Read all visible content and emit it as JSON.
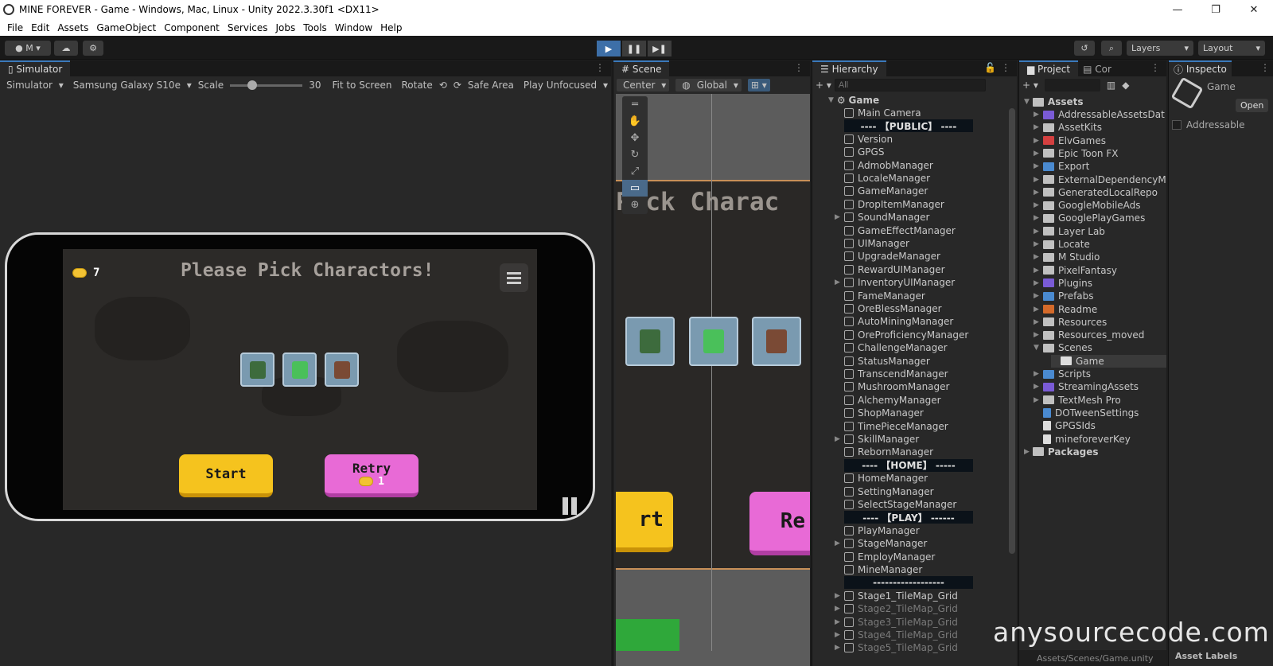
{
  "window": {
    "title": "MINE  FOREVER - Game - Windows, Mac, Linux - Unity 2022.3.30f1 <DX11>"
  },
  "menu": [
    "File",
    "Edit",
    "Assets",
    "GameObject",
    "Component",
    "Services",
    "Jobs",
    "Tools",
    "Window",
    "Help"
  ],
  "toolbar": {
    "account": "M",
    "layers": "Layers",
    "layout": "Layout"
  },
  "simulator": {
    "tab": "Simulator",
    "mode": "Simulator",
    "device": "Samsung Galaxy S10e",
    "scale_label": "Scale",
    "scale_value": "30",
    "fit": "Fit to Screen",
    "rotate": "Rotate",
    "safe_area": "Safe Area",
    "play_mode": "Play Unfocused"
  },
  "game": {
    "coins": "7",
    "title": "Please Pick Charactors!",
    "start": "Start",
    "retry": "Retry",
    "retry_cost": "1"
  },
  "scene": {
    "tab": "Scene",
    "pivot": "Center",
    "space": "Global",
    "banner": "Pick Charac",
    "btn_left": "rt",
    "btn_right": "Re"
  },
  "hierarchy": {
    "tab": "Hierarchy",
    "search_placeholder": "All",
    "root": "Game",
    "items": [
      {
        "label": "Main Camera",
        "type": "obj"
      },
      {
        "label": "---- 【PUBLIC】 ----",
        "type": "sep"
      },
      {
        "label": "Version",
        "type": "obj"
      },
      {
        "label": "GPGS",
        "type": "obj"
      },
      {
        "label": "AdmobManager",
        "type": "obj"
      },
      {
        "label": "LocaleManager",
        "type": "obj"
      },
      {
        "label": "GameManager",
        "type": "obj"
      },
      {
        "label": "DropItemManager",
        "type": "obj"
      },
      {
        "label": "SoundManager",
        "type": "obj",
        "arrow": true
      },
      {
        "label": "GameEffectManager",
        "type": "obj"
      },
      {
        "label": "UIManager",
        "type": "obj"
      },
      {
        "label": "UpgradeManager",
        "type": "obj"
      },
      {
        "label": "RewardUIManager",
        "type": "obj"
      },
      {
        "label": "InventoryUIManager",
        "type": "obj",
        "arrow": true
      },
      {
        "label": "FameManager",
        "type": "obj"
      },
      {
        "label": "OreBlessManager",
        "type": "obj"
      },
      {
        "label": "AutoMiningManager",
        "type": "obj"
      },
      {
        "label": "OreProficiencyManager",
        "type": "obj"
      },
      {
        "label": "ChallengeManager",
        "type": "obj"
      },
      {
        "label": "StatusManager",
        "type": "obj"
      },
      {
        "label": "TranscendManager",
        "type": "obj"
      },
      {
        "label": "MushroomManager",
        "type": "obj"
      },
      {
        "label": "AlchemyManager",
        "type": "obj"
      },
      {
        "label": "ShopManager",
        "type": "obj"
      },
      {
        "label": "TimePieceManager",
        "type": "obj"
      },
      {
        "label": "SkillManager",
        "type": "obj",
        "arrow": true
      },
      {
        "label": "RebornManager",
        "type": "obj"
      },
      {
        "label": "---- 【HOME】 -----",
        "type": "sep"
      },
      {
        "label": "HomeManager",
        "type": "obj"
      },
      {
        "label": "SettingManager",
        "type": "obj"
      },
      {
        "label": "SelectStageManager",
        "type": "obj"
      },
      {
        "label": "---- 【PLAY】 ------",
        "type": "sep"
      },
      {
        "label": "PlayManager",
        "type": "obj"
      },
      {
        "label": "StageManager",
        "type": "obj",
        "arrow": true
      },
      {
        "label": "EmployManager",
        "type": "obj"
      },
      {
        "label": "MineManager",
        "type": "obj"
      },
      {
        "label": "------------------",
        "type": "sep"
      },
      {
        "label": "Stage1_TileMap_Grid",
        "type": "obj",
        "arrow": true
      },
      {
        "label": "Stage2_TileMap_Grid",
        "type": "dim",
        "arrow": true
      },
      {
        "label": "Stage3_TileMap_Grid",
        "type": "dim",
        "arrow": true
      },
      {
        "label": "Stage4_TileMap_Grid",
        "type": "dim",
        "arrow": true
      },
      {
        "label": "Stage5_TileMap_Grid",
        "type": "dim",
        "arrow": true
      }
    ]
  },
  "project": {
    "tab": "Project",
    "tab2": "Cor",
    "root": "Assets",
    "items": [
      {
        "label": "AddressableAssetsDat",
        "color": "#7a5bd6",
        "depth": 1
      },
      {
        "label": "AssetKits",
        "color": "#c0c0c0",
        "depth": 1
      },
      {
        "label": "ElvGames",
        "color": "#d44040",
        "depth": 1
      },
      {
        "label": "Epic Toon FX",
        "color": "#c0c0c0",
        "depth": 1
      },
      {
        "label": "Export",
        "color": "#4a8ad0",
        "depth": 1
      },
      {
        "label": "ExternalDependencyM",
        "color": "#c0c0c0",
        "depth": 1
      },
      {
        "label": "GeneratedLocalRepo",
        "color": "#c0c0c0",
        "depth": 1
      },
      {
        "label": "GoogleMobileAds",
        "color": "#c0c0c0",
        "depth": 1
      },
      {
        "label": "GooglePlayGames",
        "color": "#c0c0c0",
        "depth": 1
      },
      {
        "label": "Layer Lab",
        "color": "#c0c0c0",
        "depth": 1
      },
      {
        "label": "Locate",
        "color": "#c0c0c0",
        "depth": 1
      },
      {
        "label": "M Studio",
        "color": "#c0c0c0",
        "depth": 1
      },
      {
        "label": "PixelFantasy",
        "color": "#c0c0c0",
        "depth": 1
      },
      {
        "label": "Plugins",
        "color": "#7a5bd6",
        "depth": 1
      },
      {
        "label": "Prefabs",
        "color": "#4a8ad0",
        "depth": 1
      },
      {
        "label": "Readme",
        "color": "#d46a2a",
        "depth": 1
      },
      {
        "label": "Resources",
        "color": "#c0c0c0",
        "depth": 1
      },
      {
        "label": "Resources_moved",
        "color": "#c0c0c0",
        "depth": 1
      },
      {
        "label": "Scenes",
        "color": "#c0c0c0",
        "depth": 1,
        "open": true
      },
      {
        "label": "Game",
        "color": "#dddddd",
        "depth": 2,
        "selected": true
      },
      {
        "label": "Scripts",
        "color": "#4a8ad0",
        "depth": 1
      },
      {
        "label": "StreamingAssets",
        "color": "#7a5bd6",
        "depth": 1
      },
      {
        "label": "TextMesh Pro",
        "color": "#c0c0c0",
        "depth": 1
      },
      {
        "label": "DOTweenSettings",
        "color": "#4a8ad0",
        "depth": 1,
        "file": true
      },
      {
        "label": "GPGSIds",
        "color": "#dddddd",
        "depth": 1,
        "file": true
      },
      {
        "label": "mineforeverKey",
        "color": "#dddddd",
        "depth": 1,
        "file": true
      }
    ],
    "packages": "Packages",
    "footer_path": "Assets/Scenes/Game.unity"
  },
  "inspector": {
    "tab": "Inspecto",
    "object": "Game",
    "open_btn": "Open",
    "addressable": "Addressable",
    "asset_labels": "Asset Labels"
  },
  "watermark": "anysourcecode.com"
}
